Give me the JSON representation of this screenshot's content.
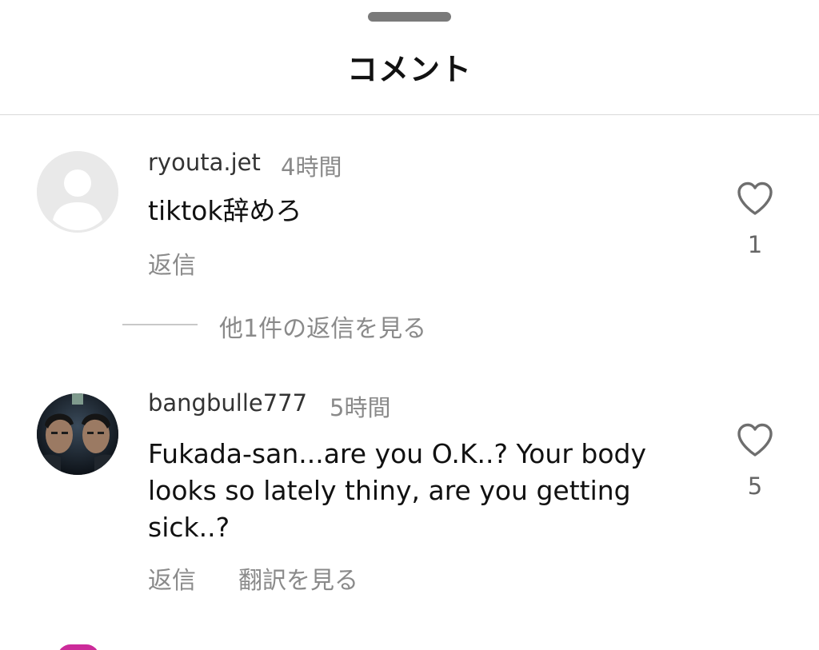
{
  "sheet": {
    "title": "コメント"
  },
  "comments": [
    {
      "username": "ryouta.jet",
      "time": "4時間",
      "text": "tiktok辞めろ",
      "reply_label": "返信",
      "like_count": "1",
      "view_replies_label": "他1件の返信を見る",
      "avatar_icon": "default-avatar-icon"
    },
    {
      "username": "bangbulle777",
      "time": "5時間",
      "text_lines": [
        "Fukada-san...are you O.K..? Your body",
        "looks so lately thiny, are you getting",
        "sick..?"
      ],
      "reply_label": "返信",
      "translate_label": "翻訳を見る",
      "like_count": "5",
      "avatar_icon": "profile-photo"
    }
  ],
  "colors": {
    "text_primary": "#111111",
    "text_secondary": "#8a8a8a",
    "divider": "#d9d9d9",
    "handle": "#7a7a7a"
  }
}
